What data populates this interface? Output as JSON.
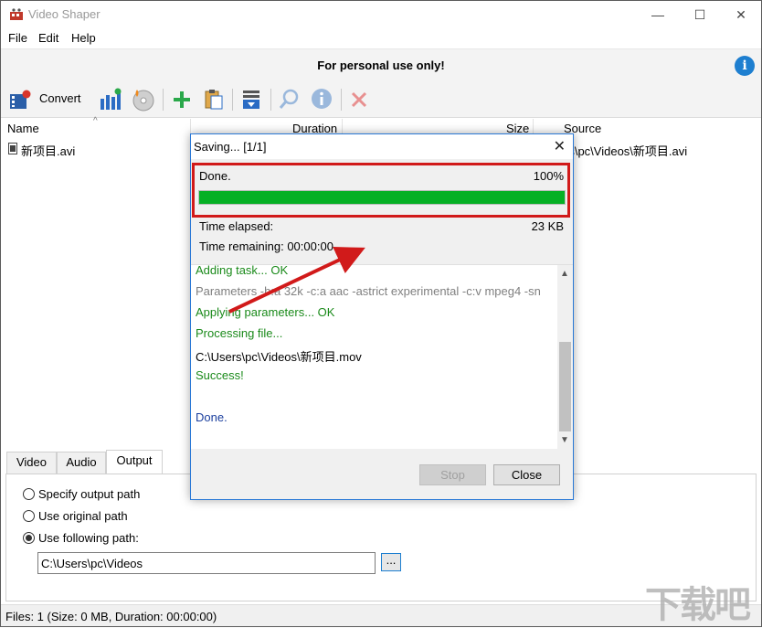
{
  "window": {
    "title": "Video Shaper",
    "minimize": "—",
    "maximize": "☐",
    "close": "✕"
  },
  "menu": [
    "File",
    "Edit",
    "Help"
  ],
  "banner": {
    "text": "For personal use only!",
    "info": "i"
  },
  "toolbar": {
    "convert_label": "Convert"
  },
  "columns": {
    "name": "Name",
    "duration": "Duration",
    "size": "Size",
    "source": "Source"
  },
  "files": [
    {
      "name": "新项目.avi",
      "source": "rs\\pc\\Videos\\新项目.avi"
    }
  ],
  "tabs": [
    "Video",
    "Audio",
    "Output"
  ],
  "output": {
    "options": [
      "Specify output path",
      "Use original path",
      "Use following path:"
    ],
    "selected": 2,
    "path": "C:\\Users\\pc\\Videos",
    "browse": "..."
  },
  "status": "Files: 1 (Size: 0 MB, Duration: 00:00:00)",
  "dialog": {
    "title": "Saving... [1/1]",
    "close": "✕",
    "done": "Done.",
    "percent": "100%",
    "progress_fraction": 1.0,
    "elapsed_label": "Time elapsed:",
    "size": "23 KB",
    "remaining": "Time remaining: 00:00:00",
    "log": [
      {
        "text": "Adding task... OK",
        "cls": "green"
      },
      {
        "text": "Parameters -b:a 32k -c:a aac -astrict experimental -c:v mpeg4 -sn",
        "cls": "gray"
      },
      {
        "text": "Applying parameters... OK",
        "cls": "green"
      },
      {
        "text": "Processing file...",
        "cls": "green"
      },
      {
        "text": "C:\\Users\\pc\\Videos\\新项目.mov",
        "cls": "black"
      },
      {
        "text": "Success!",
        "cls": "green"
      },
      {
        "text": "",
        "cls": "black"
      },
      {
        "text": "Done.",
        "cls": "blue"
      }
    ],
    "stop": "Stop",
    "close_btn": "Close"
  },
  "watermark": "下载吧",
  "colors": {
    "progress": "#06b025",
    "highlight": "#d11a1a",
    "accent": "#1e7fd0"
  }
}
